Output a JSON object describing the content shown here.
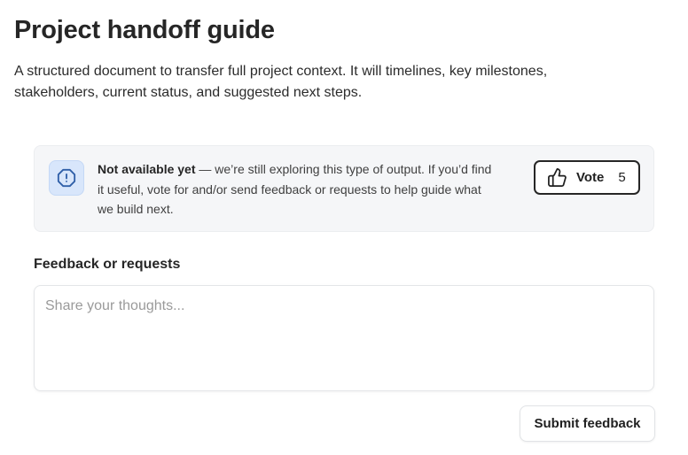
{
  "header": {
    "title": "Project handoff guide",
    "description": "A structured document to transfer full project context. It will timelines, key milestones, stakeholders, current status, and suggested next steps."
  },
  "notice": {
    "icon": "alert-octagon-icon",
    "strong_text": "Not available yet",
    "body_text": " — we’re still exploring this type of output. If you’d find it useful, vote for and/or send feedback or requests to help guide what we build next.",
    "colors": {
      "background": "#f5f6f8",
      "icon_background": "#d8e6fb",
      "icon_stroke": "#2f5fa8"
    }
  },
  "vote": {
    "label": "Vote",
    "count": "5",
    "icon": "thumbs-up-icon"
  },
  "feedback": {
    "label": "Feedback or requests",
    "placeholder": "Share your thoughts...",
    "value": "",
    "submit_label": "Submit feedback"
  }
}
